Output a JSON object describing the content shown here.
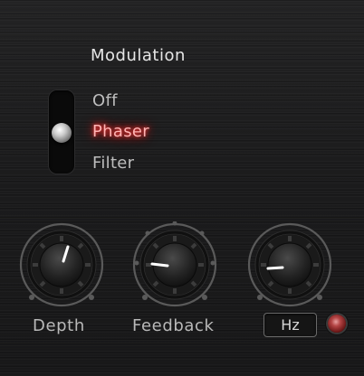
{
  "modulation": {
    "title": "Modulation",
    "options": [
      "Off",
      "Phaser",
      "Filter"
    ],
    "selected": "Phaser"
  },
  "knobs": {
    "depth": {
      "label": "Depth"
    },
    "feedback": {
      "label": "Feedback"
    },
    "rate": {
      "unit_label": "Hz"
    }
  },
  "colors": {
    "active_glow": "#e01f1f",
    "indicator": "#ffffff",
    "led": "#b34444"
  },
  "icons": {
    "toggle": "vertical-slide-switch",
    "rate_led": "led-indicator"
  }
}
